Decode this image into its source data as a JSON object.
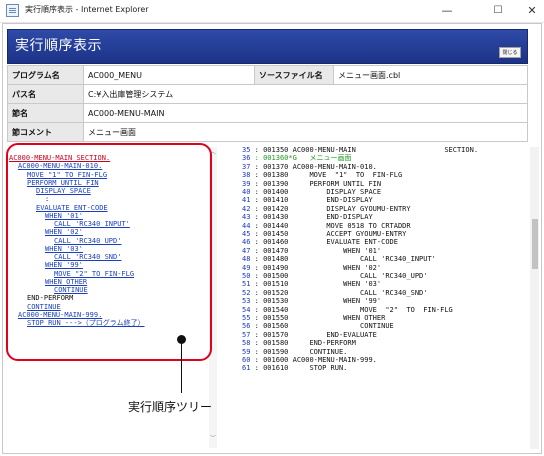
{
  "window": {
    "title": "実行順序表示 - Internet Explorer",
    "icon": "ie-window-icon",
    "minimize": "—",
    "maximize": "☐",
    "close": "✕"
  },
  "header": {
    "title": "実行順序表示",
    "close_label": "閉じる",
    "bg_color": "#233b98"
  },
  "info": {
    "program_label": "プログラム名",
    "program_value": "AC000_MENU",
    "source_label": "ソースファイル名",
    "source_value": "メニュー画面.cbl",
    "path_label": "パス名",
    "path_value": "C:¥入出庫管理システム",
    "section_label": "節名",
    "section_value": "AC000-MENU-MAIN",
    "comment_label": "節コメント",
    "comment_value": "メニュー画面"
  },
  "tree": {
    "lines": [
      {
        "text": "AC000-MENU-MAIN SECTION.",
        "indent": 0,
        "style": "red"
      },
      {
        "text": "AC000-MENU-MAIN-010.",
        "indent": 1,
        "style": "link"
      },
      {
        "text": "MOVE  \"1\"  TO  FIN-FLG",
        "indent": 2,
        "style": "link"
      },
      {
        "text": "PERFORM UNTIL FIN",
        "indent": 2,
        "style": "link"
      },
      {
        "text": "DISPLAY SPACE",
        "indent": 3,
        "style": "link"
      },
      {
        "text": ":",
        "indent": 4,
        "style": "plain"
      },
      {
        "text": "EVALUATE ENT-CODE",
        "indent": 3,
        "style": "link"
      },
      {
        "text": "WHEN  '01'",
        "indent": 4,
        "style": "link"
      },
      {
        "text": "CALL  'RC340_INPUT'",
        "indent": 5,
        "style": "link"
      },
      {
        "text": "WHEN  '02'",
        "indent": 4,
        "style": "link"
      },
      {
        "text": "CALL  'RC340_UPD'",
        "indent": 5,
        "style": "link"
      },
      {
        "text": "WHEN  '03'",
        "indent": 4,
        "style": "link"
      },
      {
        "text": "CALL  'RC340_SND'",
        "indent": 5,
        "style": "link"
      },
      {
        "text": "WHEN  '99'",
        "indent": 4,
        "style": "link"
      },
      {
        "text": "MOVE  \"2\"  TO FIN-FLG",
        "indent": 5,
        "style": "link"
      },
      {
        "text": "WHEN OTHER",
        "indent": 4,
        "style": "link"
      },
      {
        "text": "CONTINUE",
        "indent": 5,
        "style": "link"
      },
      {
        "text": "END-PERFORM",
        "indent": 2,
        "style": "plain"
      },
      {
        "text": "CONTINUE",
        "indent": 2,
        "style": "link"
      },
      {
        "text": "AC000-MENU-MAIN-999.",
        "indent": 1,
        "style": "link"
      },
      {
        "text": "STOP RUN --->（プログラム終了）",
        "indent": 2,
        "style": "link"
      }
    ],
    "scroll_up": "︿",
    "scroll_down": "﹀"
  },
  "code": {
    "lines": [
      {
        "ln": "35",
        "seq": "001350",
        "text": "AC000-MENU-MAIN                     SECTION.",
        "style": "normal"
      },
      {
        "ln": "36",
        "seq": "001360*G",
        "text": "  メニュー画面",
        "style": "green"
      },
      {
        "ln": "37",
        "seq": "001370",
        "text": "AC000-MENU-MAIN-010.",
        "style": "normal"
      },
      {
        "ln": "38",
        "seq": "001380",
        "text": "    MOVE  \"1\"  TO  FIN-FLG",
        "style": "normal"
      },
      {
        "ln": "39",
        "seq": "001390",
        "text": "    PERFORM UNTIL FIN",
        "style": "normal"
      },
      {
        "ln": "40",
        "seq": "001400",
        "text": "        DISPLAY SPACE",
        "style": "normal"
      },
      {
        "ln": "41",
        "seq": "001410",
        "text": "        END-DISPLAY",
        "style": "normal"
      },
      {
        "ln": "42",
        "seq": "001420",
        "text": "        DISPLAY GYOUMU-ENTRY",
        "style": "normal"
      },
      {
        "ln": "43",
        "seq": "001430",
        "text": "        END-DISPLAY",
        "style": "normal"
      },
      {
        "ln": "44",
        "seq": "001440",
        "text": "        MOVE 0518 TO CRTADDR",
        "style": "normal"
      },
      {
        "ln": "45",
        "seq": "001450",
        "text": "        ACCEPT GYOUMU-ENTRY",
        "style": "normal"
      },
      {
        "ln": "46",
        "seq": "001460",
        "text": "        EVALUATE ENT-CODE",
        "style": "normal"
      },
      {
        "ln": "47",
        "seq": "001470",
        "text": "            WHEN '01'",
        "style": "normal"
      },
      {
        "ln": "48",
        "seq": "001480",
        "text": "                CALL 'RC340_INPUT'",
        "style": "normal"
      },
      {
        "ln": "49",
        "seq": "001490",
        "text": "            WHEN '02'",
        "style": "normal"
      },
      {
        "ln": "50",
        "seq": "001500",
        "text": "                CALL 'RC340_UPD'",
        "style": "normal"
      },
      {
        "ln": "51",
        "seq": "001510",
        "text": "            WHEN '03'",
        "style": "normal"
      },
      {
        "ln": "52",
        "seq": "001520",
        "text": "                CALL 'RC340_SND'",
        "style": "normal"
      },
      {
        "ln": "53",
        "seq": "001530",
        "text": "            WHEN '99'",
        "style": "normal"
      },
      {
        "ln": "54",
        "seq": "001540",
        "text": "                MOVE  \"2\"  TO  FIN-FLG",
        "style": "normal"
      },
      {
        "ln": "55",
        "seq": "001550",
        "text": "            WHEN OTHER",
        "style": "normal"
      },
      {
        "ln": "56",
        "seq": "001560",
        "text": "                CONTINUE",
        "style": "normal"
      },
      {
        "ln": "57",
        "seq": "001570",
        "text": "        END-EVALUATE",
        "style": "normal"
      },
      {
        "ln": "58",
        "seq": "001580",
        "text": "    END-PERFORM",
        "style": "normal"
      },
      {
        "ln": "59",
        "seq": "001590",
        "text": "    CONTINUE.",
        "style": "normal"
      },
      {
        "ln": "60",
        "seq": "001600",
        "text": "AC000-MENU-MAIN-999.",
        "style": "normal"
      },
      {
        "ln": "61",
        "seq": "001610",
        "text": "    STOP RUN.",
        "style": "normal"
      }
    ]
  },
  "callout": {
    "label": "実行順序ツリー",
    "color": "#e0001b"
  }
}
